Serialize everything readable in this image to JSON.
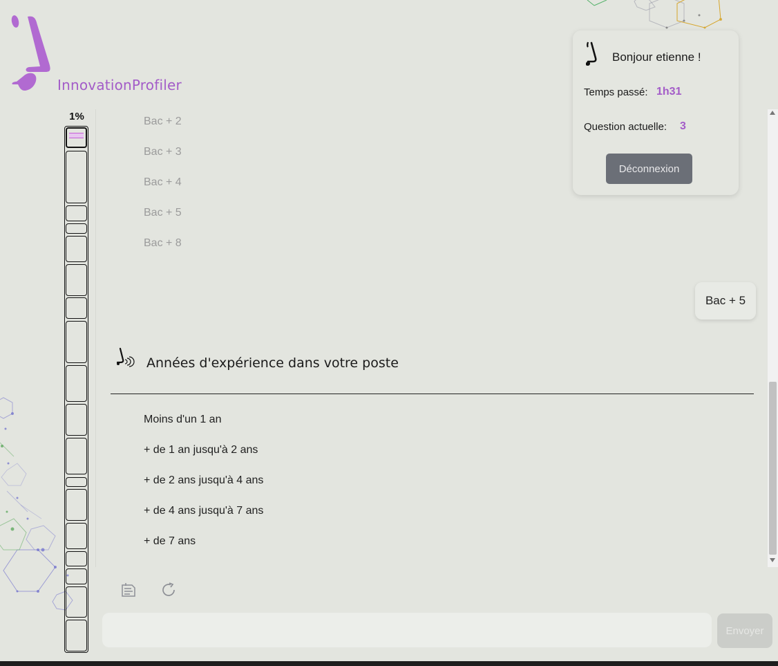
{
  "app": {
    "name": "InnovationProfiler",
    "brand_color": "#a35cc8"
  },
  "progress": {
    "percent_label": "1%",
    "fraction": 0.01
  },
  "user_card": {
    "greeting": "Bonjour etienne !",
    "time_label": "Temps passé:",
    "time_value": "1h31",
    "question_label": "Question actuelle:",
    "question_value": "3",
    "logout_label": "Déconnexion"
  },
  "previous_question": {
    "options": [
      "Bac + 2",
      "Bac + 3",
      "Bac + 4",
      "Bac + 5",
      "Bac + 8"
    ],
    "selected_answer": "Bac + 5"
  },
  "current_question": {
    "title": "Années d'expérience dans votre poste",
    "options": [
      "Moins d'un 1 an",
      "+ de 1 an jusqu'à 2 ans",
      "+ de 2 ans jusqu'à 4 ans",
      "+ de 4 ans jusqu'à 7 ans",
      "+ de 7 ans"
    ]
  },
  "toolbar": {
    "icons": [
      "notes-icon",
      "refresh-icon"
    ]
  },
  "composer": {
    "input_value": "",
    "send_label": "Envoyer"
  }
}
